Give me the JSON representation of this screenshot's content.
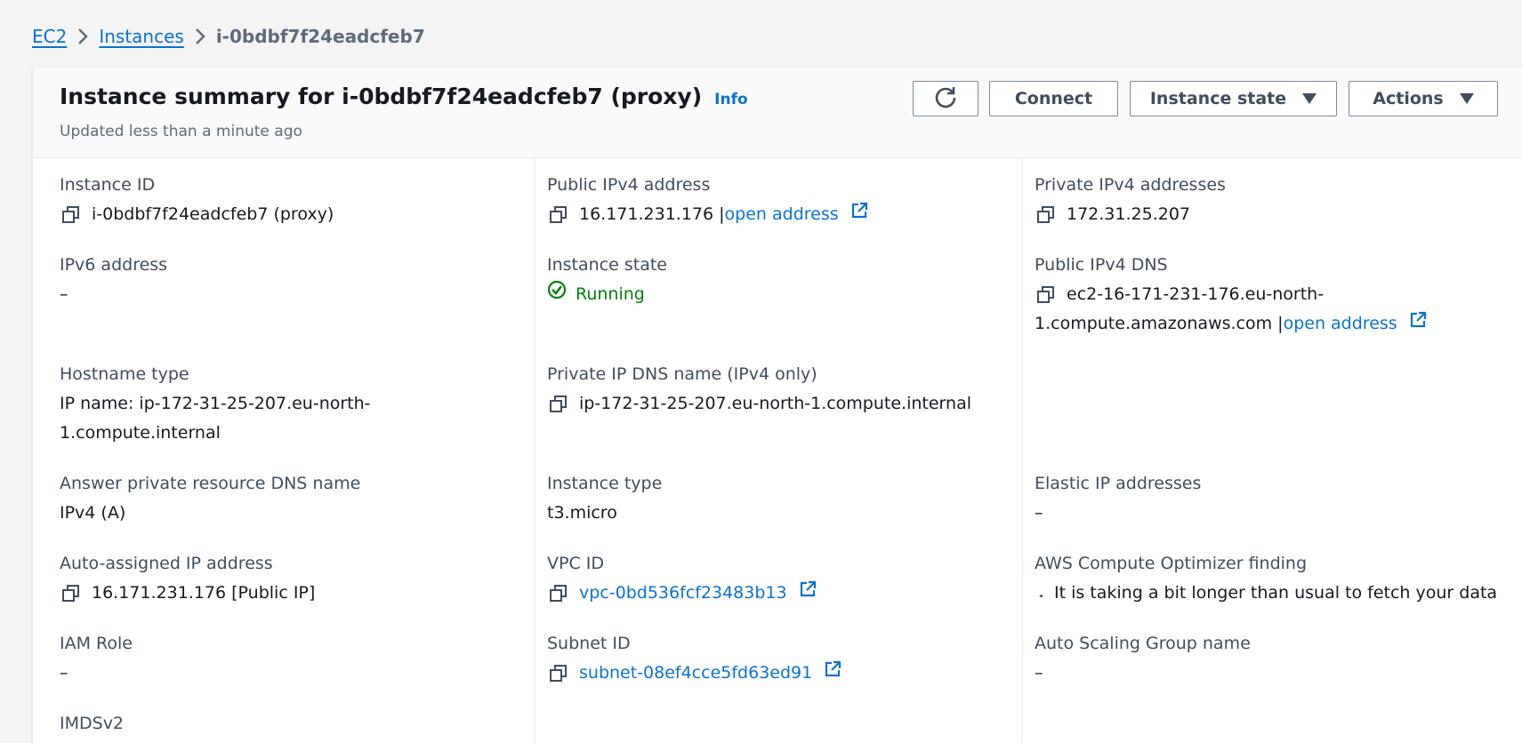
{
  "breadcrumb": {
    "items": [
      "EC2",
      "Instances"
    ],
    "current": "i-0bdbf7f24eadcfeb7"
  },
  "header": {
    "title": "Instance summary for i-0bdbf7f24eadcfeb7 (proxy)",
    "info": "Info",
    "updated": "Updated less than a minute ago",
    "buttons": {
      "connect": "Connect",
      "instance_state": "Instance state",
      "actions": "Actions"
    }
  },
  "fields": {
    "instance_id": {
      "label": "Instance ID",
      "value": "i-0bdbf7f24eadcfeb7 (proxy)"
    },
    "public_ipv4": {
      "label": "Public IPv4 address",
      "value": "16.171.231.176",
      "sep": "|",
      "link": "open address"
    },
    "private_ipv4": {
      "label": "Private IPv4 addresses",
      "value": "172.31.25.207"
    },
    "ipv6": {
      "label": "IPv6 address",
      "value": "–"
    },
    "instance_state": {
      "label": "Instance state",
      "value": "Running"
    },
    "public_dns": {
      "label": "Public IPv4 DNS",
      "value_line1": "ec2-16-171-231-176.eu-north-",
      "value_line2": "1.compute.amazonaws.com",
      "sep": "|",
      "link": "open address"
    },
    "hostname_type": {
      "label": "Hostname type",
      "value_line1": "IP name: ip-172-31-25-207.eu-north-",
      "value_line2": "1.compute.internal"
    },
    "private_dns": {
      "label": "Private IP DNS name (IPv4 only)",
      "value": "ip-172-31-25-207.eu-north-1.compute.internal"
    },
    "answer_dns": {
      "label": "Answer private resource DNS name",
      "value": "IPv4 (A)"
    },
    "instance_type": {
      "label": "Instance type",
      "value": "t3.micro"
    },
    "elastic_ip": {
      "label": "Elastic IP addresses",
      "value": "–"
    },
    "auto_ip": {
      "label": "Auto-assigned IP address",
      "value": "16.171.231.176 [Public IP]"
    },
    "vpc_id": {
      "label": "VPC ID",
      "value": "vpc-0bd536fcf23483b13"
    },
    "optimizer": {
      "label": "AWS Compute Optimizer finding",
      "value": "It is taking a bit longer than usual to fetch your data"
    },
    "iam_role": {
      "label": "IAM Role",
      "value": "–"
    },
    "subnet_id": {
      "label": "Subnet ID",
      "value": "subnet-08ef4cce5fd63ed91"
    },
    "asg_name": {
      "label": "Auto Scaling Group name",
      "value": "–"
    },
    "imdsv2": {
      "label": "IMDSv2"
    }
  },
  "colors": {
    "link": "#0972d3",
    "running": "#037f0c",
    "label": "#414d5c"
  },
  "icons": [
    "chevron-right-icon",
    "refresh-icon",
    "caret-down-icon",
    "copy-icon",
    "external-link-icon",
    "check-circle-icon",
    "spinner-icon"
  ]
}
